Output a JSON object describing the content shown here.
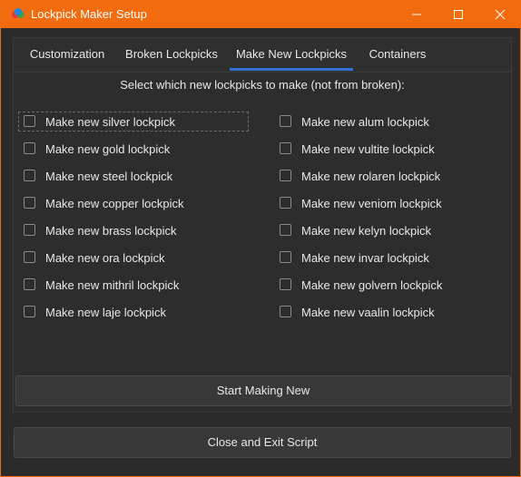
{
  "window": {
    "title": "Lockpick Maker Setup",
    "controls": {
      "minimize": "—",
      "maximize": "☐",
      "close": "✕"
    }
  },
  "tabs": [
    {
      "label": "Customization",
      "active": false
    },
    {
      "label": "Broken Lockpicks",
      "active": false
    },
    {
      "label": "Make New Lockpicks",
      "active": true
    },
    {
      "label": "Containers",
      "active": false
    }
  ],
  "instruction": "Select which new lockpicks to make (not from broken):",
  "checkboxes_left": [
    {
      "label": "Make new silver lockpick",
      "checked": false
    },
    {
      "label": "Make new gold lockpick",
      "checked": false
    },
    {
      "label": "Make new steel lockpick",
      "checked": false
    },
    {
      "label": "Make new copper lockpick",
      "checked": false
    },
    {
      "label": "Make new brass lockpick",
      "checked": false
    },
    {
      "label": "Make new ora lockpick",
      "checked": false
    },
    {
      "label": "Make new mithril lockpick",
      "checked": false
    },
    {
      "label": "Make new laje lockpick",
      "checked": false
    }
  ],
  "checkboxes_right": [
    {
      "label": "Make new alum lockpick",
      "checked": false
    },
    {
      "label": "Make new vultite lockpick",
      "checked": false
    },
    {
      "label": "Make new rolaren lockpick",
      "checked": false
    },
    {
      "label": "Make new veniom lockpick",
      "checked": false
    },
    {
      "label": "Make new kelyn lockpick",
      "checked": false
    },
    {
      "label": "Make new invar lockpick",
      "checked": false
    },
    {
      "label": "Make new golvern lockpick",
      "checked": false
    },
    {
      "label": "Make new vaalin lockpick",
      "checked": false
    }
  ],
  "buttons": {
    "start": "Start Making New",
    "close": "Close and Exit Script"
  },
  "colors": {
    "titlebar": "#F26C0F",
    "background": "#2B2B2B",
    "tab_active_underline": "#2F6FD6",
    "text": "#E8E8E8"
  }
}
